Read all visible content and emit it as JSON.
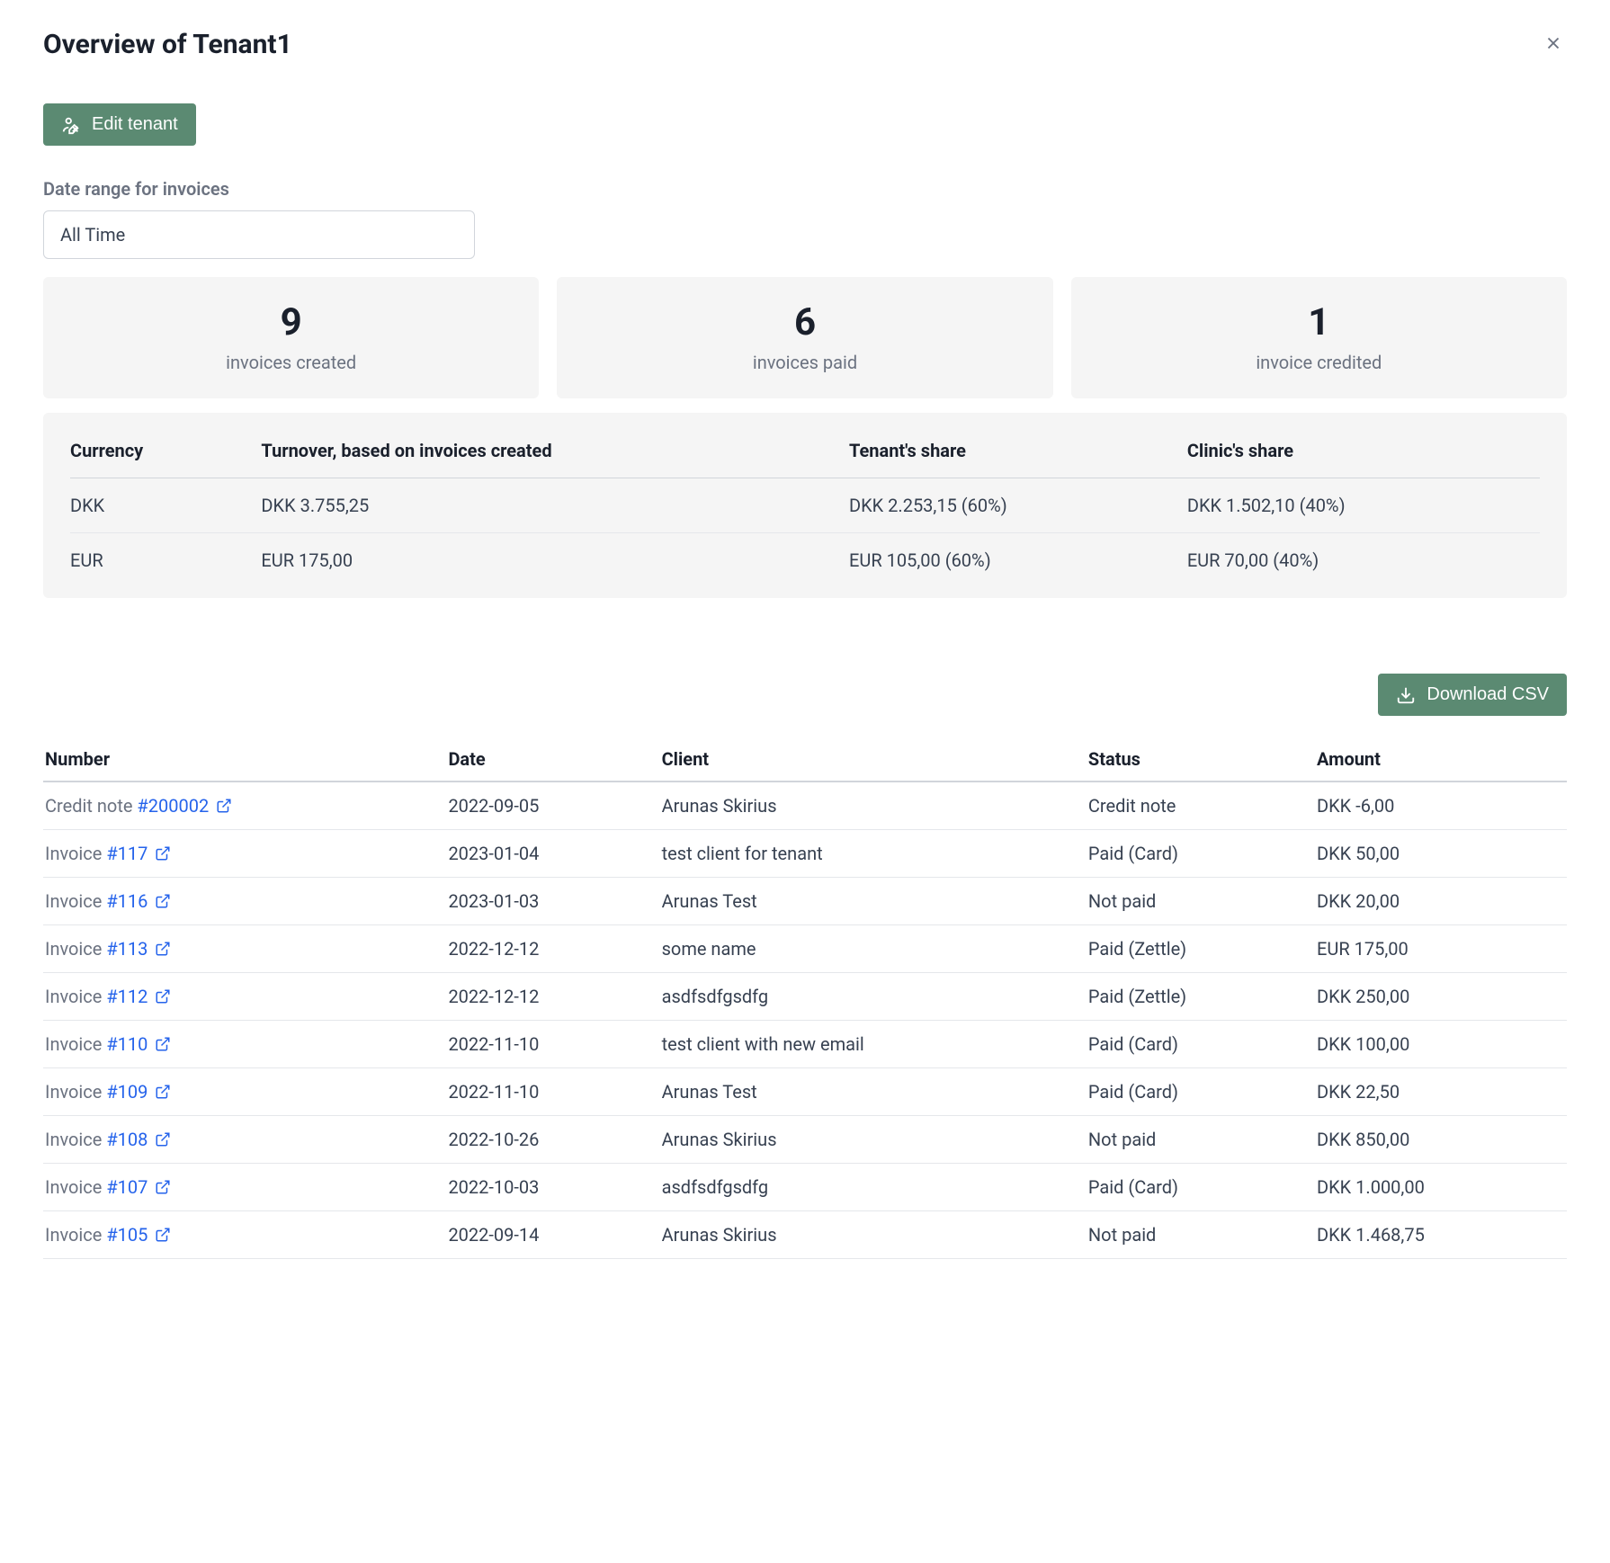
{
  "header": {
    "title": "Overview of Tenant1",
    "edit_button": "Edit tenant"
  },
  "filter": {
    "label": "Date range for invoices",
    "value": "All Time"
  },
  "stats": [
    {
      "value": "9",
      "label": "invoices created"
    },
    {
      "value": "6",
      "label": "invoices paid"
    },
    {
      "value": "1",
      "label": "invoice credited"
    }
  ],
  "summary": {
    "headers": {
      "currency": "Currency",
      "turnover": "Turnover, based on invoices created",
      "tenant_share": "Tenant's share",
      "clinic_share": "Clinic's share"
    },
    "rows": [
      {
        "currency": "DKK",
        "turnover": "DKK 3.755,25",
        "tenant_share": "DKK 2.253,15 (60%)",
        "clinic_share": "DKK 1.502,10 (40%)"
      },
      {
        "currency": "EUR",
        "turnover": "EUR 175,00",
        "tenant_share": "EUR 105,00 (60%)",
        "clinic_share": "EUR 70,00 (40%)"
      }
    ]
  },
  "download_button": "Download CSV",
  "invoices": {
    "headers": {
      "number": "Number",
      "date": "Date",
      "client": "Client",
      "status": "Status",
      "amount": "Amount"
    },
    "rows": [
      {
        "prefix": "Credit note ",
        "link": "#200002",
        "date": "2022-09-05",
        "client": "Arunas Skirius",
        "status": "Credit note",
        "amount": "DKK -6,00"
      },
      {
        "prefix": "Invoice ",
        "link": "#117",
        "date": "2023-01-04",
        "client": "test client for tenant",
        "status": "Paid (Card)",
        "amount": "DKK 50,00"
      },
      {
        "prefix": "Invoice ",
        "link": "#116",
        "date": "2023-01-03",
        "client": "Arunas Test",
        "status": "Not paid",
        "amount": "DKK 20,00"
      },
      {
        "prefix": "Invoice ",
        "link": "#113",
        "date": "2022-12-12",
        "client": "some name",
        "status": "Paid (Zettle)",
        "amount": "EUR 175,00"
      },
      {
        "prefix": "Invoice ",
        "link": "#112",
        "date": "2022-12-12",
        "client": "asdfsdfgsdfg",
        "status": "Paid (Zettle)",
        "amount": "DKK 250,00"
      },
      {
        "prefix": "Invoice ",
        "link": "#110",
        "date": "2022-11-10",
        "client": "test client with new email",
        "status": "Paid (Card)",
        "amount": "DKK 100,00"
      },
      {
        "prefix": "Invoice ",
        "link": "#109",
        "date": "2022-11-10",
        "client": "Arunas Test",
        "status": "Paid (Card)",
        "amount": "DKK 22,50"
      },
      {
        "prefix": "Invoice ",
        "link": "#108",
        "date": "2022-10-26",
        "client": "Arunas Skirius",
        "status": "Not paid",
        "amount": "DKK 850,00"
      },
      {
        "prefix": "Invoice ",
        "link": "#107",
        "date": "2022-10-03",
        "client": "asdfsdfgsdfg",
        "status": "Paid (Card)",
        "amount": "DKK 1.000,00"
      },
      {
        "prefix": "Invoice ",
        "link": "#105",
        "date": "2022-09-14",
        "client": "Arunas Skirius",
        "status": "Not paid",
        "amount": "DKK 1.468,75"
      }
    ]
  }
}
